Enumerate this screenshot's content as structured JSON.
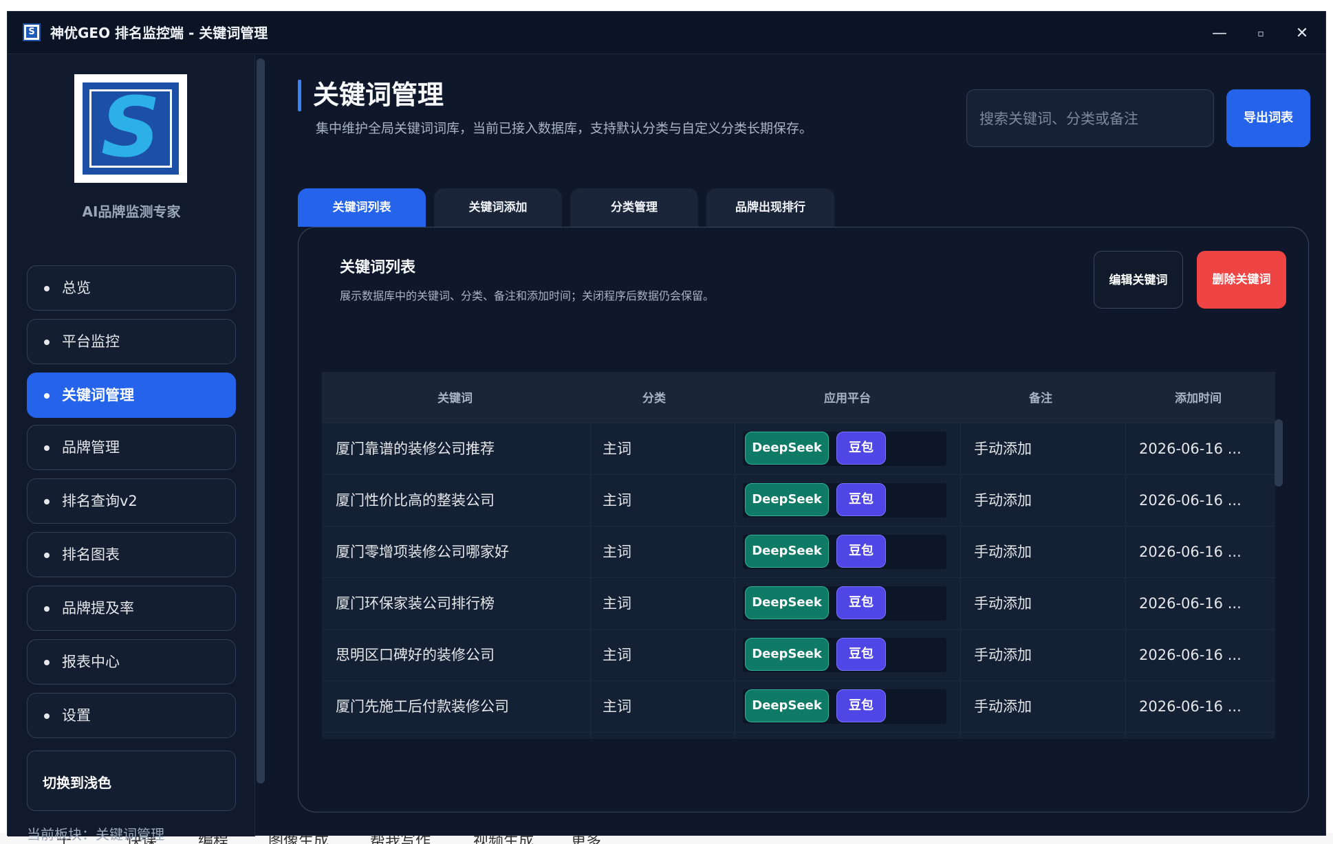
{
  "background_app": {
    "bottom_items": [
      "十",
      "快课",
      "编程",
      "图像生成",
      "帮我写作",
      "视频生成",
      "更多"
    ]
  },
  "window": {
    "title": "神优GEO 排名监控端 - 关键词管理",
    "minimize": "—",
    "maximize": "▫",
    "close": "✕"
  },
  "sidebar": {
    "logo_letter": "S",
    "tagline": "AI品牌监测专家",
    "items": [
      {
        "label": "总览"
      },
      {
        "label": "平台监控"
      },
      {
        "label": "关键词管理"
      },
      {
        "label": "品牌管理"
      },
      {
        "label": "排名查询v2"
      },
      {
        "label": "排名图表"
      },
      {
        "label": "品牌提及率"
      },
      {
        "label": "报表中心"
      },
      {
        "label": "设置"
      }
    ],
    "active_index": 2,
    "theme_toggle": "切换到浅色",
    "current_block": "当前板块：关键词管理"
  },
  "header": {
    "title": "关键词管理",
    "subtitle": "集中维护全局关键词词库，当前已接入数据库，支持默认分类与自定义分类长期保存。",
    "search_placeholder": "搜索关键词、分类或备注",
    "export_label": "导出词表"
  },
  "tabs": [
    {
      "label": "关键词列表",
      "active": true
    },
    {
      "label": "关键词添加",
      "active": false
    },
    {
      "label": "分类管理",
      "active": false
    },
    {
      "label": "品牌出现排行",
      "active": false
    }
  ],
  "panel": {
    "title": "关键词列表",
    "subtitle": "展示数据库中的关键词、分类、备注和添加时间；关闭程序后数据仍会保留。",
    "edit_label": "编辑关键词",
    "delete_label": "删除关键词"
  },
  "table": {
    "columns": [
      "关键词",
      "分类",
      "应用平台",
      "备注",
      "添加时间"
    ],
    "rows": [
      {
        "keyword": "厦门靠谱的装修公司推荐",
        "category": "主词",
        "platforms": [
          "DeepSeek",
          "豆包"
        ],
        "note": "手动添加",
        "time": "2026-06-16 ..."
      },
      {
        "keyword": "厦门性价比高的整装公司",
        "category": "主词",
        "platforms": [
          "DeepSeek",
          "豆包"
        ],
        "note": "手动添加",
        "time": "2026-06-16 ..."
      },
      {
        "keyword": "厦门零增项装修公司哪家好",
        "category": "主词",
        "platforms": [
          "DeepSeek",
          "豆包"
        ],
        "note": "手动添加",
        "time": "2026-06-16 ..."
      },
      {
        "keyword": "厦门环保家装公司排行榜",
        "category": "主词",
        "platforms": [
          "DeepSeek",
          "豆包"
        ],
        "note": "手动添加",
        "time": "2026-06-16 ..."
      },
      {
        "keyword": "思明区口碑好的装修公司",
        "category": "主词",
        "platforms": [
          "DeepSeek",
          "豆包"
        ],
        "note": "手动添加",
        "time": "2026-06-16 ..."
      },
      {
        "keyword": "厦门先施工后付款装修公司",
        "category": "主词",
        "platforms": [
          "DeepSeek",
          "豆包"
        ],
        "note": "手动添加",
        "time": "2026-06-16 ..."
      }
    ]
  },
  "colors": {
    "accent": "#2563eb",
    "danger": "#ef4444",
    "deepseek_chip": "#0f7a66",
    "doubao_chip": "#4f46e5",
    "window_bg": "#0f172a"
  }
}
